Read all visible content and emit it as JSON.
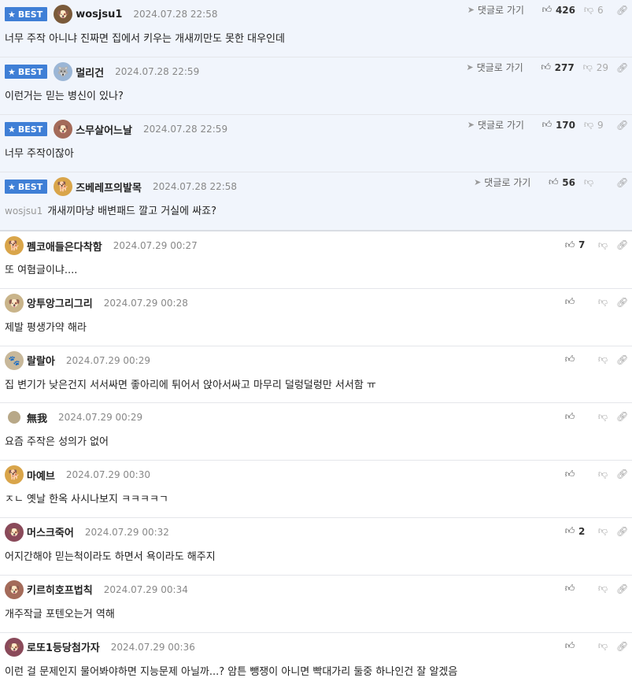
{
  "labels": {
    "best": "BEST",
    "goto": "댓글로 가기"
  },
  "icons": {
    "star": "star-icon",
    "like": "thumbs-up-icon",
    "dislike": "thumbs-down-icon",
    "link": "link-icon",
    "reply": "paper-plane-icon"
  },
  "colors": {
    "best_badge": "#3f7fd6",
    "best_bg": "#f1f5fc"
  },
  "best_comments": [
    {
      "nick": "wosjsu1",
      "date": "2024.07.28 22:58",
      "text": "너무 주작 아니냐 진짜면 집에서 키우는 개새끼만도 못한 대우인데",
      "likes": "426",
      "dislikes": "6",
      "reply_to": ""
    },
    {
      "nick": "멀리건",
      "date": "2024.07.28 22:59",
      "text": "이런거는 믿는 병신이 있나?",
      "likes": "277",
      "dislikes": "29",
      "reply_to": ""
    },
    {
      "nick": "스무살어느날",
      "date": "2024.07.28 22:59",
      "text": "너무 주작이잖아",
      "likes": "170",
      "dislikes": "9",
      "reply_to": ""
    },
    {
      "nick": "즈베레프의발목",
      "date": "2024.07.28 22:58",
      "text": "개새끼마냥 배변패드 깔고 거실에 싸죠?",
      "likes": "56",
      "dislikes": "",
      "reply_to": "wosjsu1"
    }
  ],
  "comments": [
    {
      "nick": "펨코애들은다착함",
      "date": "2024.07.29 00:27",
      "text": "또 여혐글이냐....",
      "likes": "7"
    },
    {
      "nick": "앙투앙그리그리",
      "date": "2024.07.29 00:28",
      "text": "제발 평생가약 해라",
      "likes": ""
    },
    {
      "nick": "랄랄아",
      "date": "2024.07.29 00:29",
      "text": "집 변기가 낮은건지 서서싸면 좋아리에 튀어서 앉아서싸고 마무리 덜렁덜렁만 서서함 ㅠ",
      "likes": ""
    },
    {
      "nick": "無我",
      "date": "2024.07.29 00:29",
      "text": "요즘 주작은 성의가 없어",
      "likes": ""
    },
    {
      "nick": "마예브",
      "date": "2024.07.29 00:30",
      "text": "ㅈㄴ 옛날 한옥 사시나보지 ㅋㅋㅋㅋㄱ",
      "likes": ""
    },
    {
      "nick": "머스크죽어",
      "date": "2024.07.29 00:32",
      "text": "어지간해야 믿는척이라도 하면서 욕이라도 해주지",
      "likes": "2"
    },
    {
      "nick": "키르히호프법칙",
      "date": "2024.07.29 00:34",
      "text": "개주작글 포텐오는거 역해",
      "likes": ""
    },
    {
      "nick": "로또1등당첨가자",
      "date": "2024.07.29 00:36",
      "text": "이런 걸 문제인지 물어봐야하면 지능문제 아닐까...? 암튼 뺑쟁이 아니면 빡대가리 둘중 하나인건 잘 알겠음",
      "likes": ""
    }
  ]
}
